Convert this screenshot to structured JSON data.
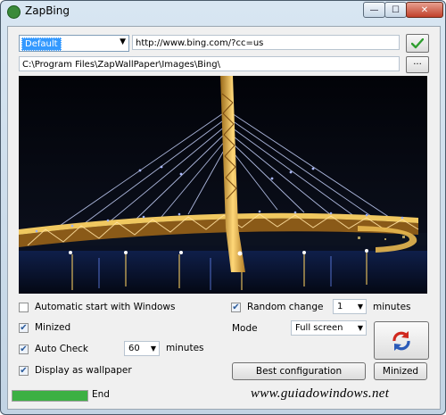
{
  "window": {
    "title": "ZapBing",
    "icon": "zapbing-app-icon",
    "controls": {
      "minimize": "—",
      "maximize": "☐",
      "close": "✕"
    }
  },
  "source": {
    "selected": "Default",
    "url": "http://www.bing.com/?cc=us",
    "ok_icon": "check-icon"
  },
  "folder": {
    "path": "C:\\Program Files\\ZapWallPaper\\Images\\Bing\\",
    "browse_label": "..."
  },
  "preview": {
    "description_icon": "bridge-wallpaper-image"
  },
  "options": {
    "auto_start": {
      "label": "Automatic start with Windows",
      "checked": false
    },
    "minimized": {
      "label": "Minized",
      "checked": true
    },
    "auto_check": {
      "label": "Auto Check",
      "checked": true,
      "value": "60",
      "unit": "minutes"
    },
    "display_wallpaper": {
      "label": "Display as wallpaper",
      "checked": true
    },
    "random_change": {
      "label": "Random change",
      "checked": true,
      "value": "1",
      "unit": "minutes"
    },
    "mode": {
      "label": "Mode",
      "value": "Full screen"
    }
  },
  "buttons": {
    "best_config": "Best configuration",
    "minimized": "Minized",
    "refresh_icon": "refresh-icon"
  },
  "status": {
    "progress": 1.0,
    "text": "End"
  },
  "watermark": "www.guiadowindows.net",
  "colors": {
    "progress": "#3cb043",
    "selection": "#3399ff",
    "check_green": "#2e9e2e",
    "refresh_red": "#d0281e",
    "refresh_blue": "#2a5ab8"
  }
}
